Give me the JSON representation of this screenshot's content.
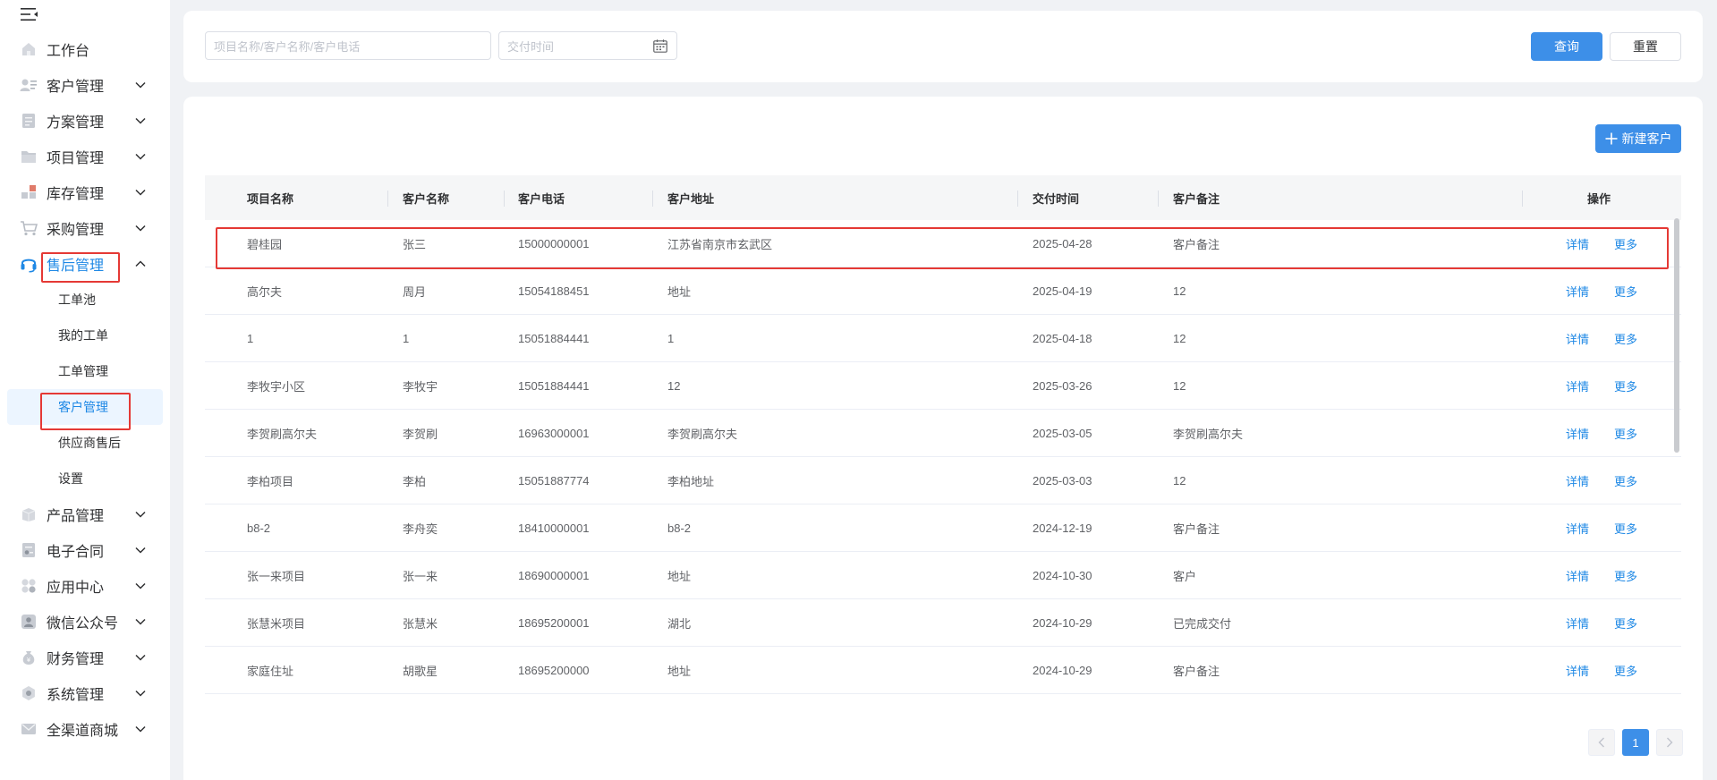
{
  "colors": {
    "accent": "#3d8fe8",
    "link": "#1e88e5",
    "highlight": "#e53935",
    "active_bg": "#ecf5ff"
  },
  "sidebar": {
    "collapse_icon": "menu-fold-icon",
    "items": [
      {
        "label": "工作台",
        "icon": "home-icon",
        "arrow": false
      },
      {
        "label": "客户管理",
        "icon": "customer-icon",
        "arrow": true
      },
      {
        "label": "方案管理",
        "icon": "document-icon",
        "arrow": true
      },
      {
        "label": "项目管理",
        "icon": "folder-icon",
        "arrow": true
      },
      {
        "label": "库存管理",
        "icon": "inventory-icon",
        "arrow": true
      },
      {
        "label": "采购管理",
        "icon": "cart-icon",
        "arrow": true
      },
      {
        "label": "售后管理",
        "icon": "headset-icon",
        "arrow": true,
        "open": true
      },
      {
        "label": "产品管理",
        "icon": "box-icon",
        "arrow": true
      },
      {
        "label": "电子合同",
        "icon": "contract-icon",
        "arrow": true
      },
      {
        "label": "应用中心",
        "icon": "apps-icon",
        "arrow": true
      },
      {
        "label": "微信公众号",
        "icon": "user-badge-icon",
        "arrow": true
      },
      {
        "label": "财务管理",
        "icon": "money-bag-icon",
        "arrow": true
      },
      {
        "label": "系统管理",
        "icon": "settings-icon",
        "arrow": true
      },
      {
        "label": "全渠道商城",
        "icon": "mail-icon",
        "arrow": true
      }
    ],
    "subitems": [
      {
        "label": "工单池"
      },
      {
        "label": "我的工单"
      },
      {
        "label": "工单管理"
      },
      {
        "label": "客户管理",
        "active": true
      },
      {
        "label": "供应商售后"
      },
      {
        "label": "设置"
      }
    ]
  },
  "search": {
    "keyword_placeholder": "项目名称/客户名称/客户电话",
    "date_placeholder": "交付时间",
    "query_label": "查询",
    "reset_label": "重置"
  },
  "main": {
    "new_customer_label": "新建客户",
    "columns": [
      "项目名称",
      "客户名称",
      "客户电话",
      "客户地址",
      "交付时间",
      "客户备注",
      "操作"
    ],
    "detail_label": "详情",
    "more_label": "更多",
    "rows": [
      {
        "project": "碧桂园",
        "name": "张三",
        "phone": "15000000001",
        "address": "江苏省南京市玄武区",
        "date": "2025-04-28",
        "note": "客户备注"
      },
      {
        "project": "高尔夫",
        "name": "周月",
        "phone": "15054188451",
        "address": "地址",
        "date": "2025-04-19",
        "note": "12"
      },
      {
        "project": "1",
        "name": "1",
        "phone": "15051884441",
        "address": "1",
        "date": "2025-04-18",
        "note": "12"
      },
      {
        "project": "李牧宇小区",
        "name": "李牧宇",
        "phone": "15051884441",
        "address": "12",
        "date": "2025-03-26",
        "note": "12"
      },
      {
        "project": "李贺刷高尔夫",
        "name": "李贺刷",
        "phone": "16963000001",
        "address": "李贺刷高尔夫",
        "date": "2025-03-05",
        "note": "李贺刷高尔夫"
      },
      {
        "project": "李柏项目",
        "name": "李柏",
        "phone": "15051887774",
        "address": "李柏地址",
        "date": "2025-03-03",
        "note": "12"
      },
      {
        "project": "b8-2",
        "name": "李舟奕",
        "phone": "18410000001",
        "address": "b8-2",
        "date": "2024-12-19",
        "note": "客户备注"
      },
      {
        "project": "张一来项目",
        "name": "张一来",
        "phone": "18690000001",
        "address": "地址",
        "date": "2024-10-30",
        "note": "客户"
      },
      {
        "project": "张慧米项目",
        "name": "张慧米",
        "phone": "18695200001",
        "address": "湖北",
        "date": "2024-10-29",
        "note": "已完成交付"
      },
      {
        "project": "家庭住址",
        "name": "胡歌星",
        "phone": "18695200000",
        "address": "地址",
        "date": "2024-10-29",
        "note": "客户备注"
      }
    ]
  },
  "pagination": {
    "current_page": "1"
  }
}
